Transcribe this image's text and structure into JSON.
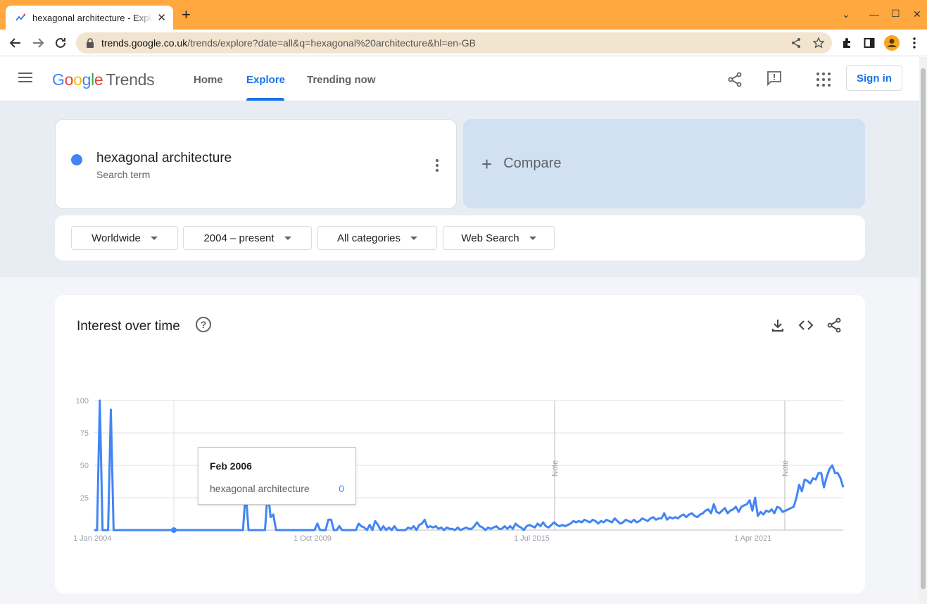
{
  "browser": {
    "tab_title": "hexagonal architecture - Explore - Google Trends",
    "url_host": "trends.google.co.uk",
    "url_path": "/trends/explore?date=all&q=hexagonal%20architecture&hl=en-GB",
    "tab_color": "#ffa840"
  },
  "header": {
    "logo_google": "Google",
    "logo_trends": "Trends",
    "nav": [
      {
        "label": "Home"
      },
      {
        "label": "Explore"
      },
      {
        "label": "Trending now"
      }
    ],
    "active_nav": "Explore",
    "signin_label": "Sign in",
    "accent": "#1a73e8"
  },
  "search": {
    "term": "hexagonal architecture",
    "term_sub": "Search term",
    "term_color": "#4285f4",
    "compare_label": "Compare",
    "compare_plus": "+"
  },
  "filters": {
    "region": "Worldwide",
    "time": "2004 – present",
    "category": "All categories",
    "search_type": "Web Search"
  },
  "iot": {
    "title": "Interest over time",
    "help": "?",
    "tooltip": {
      "date": "Feb 2006",
      "term": "hexagonal architecture",
      "value": "0"
    }
  },
  "chart_data": {
    "type": "line",
    "title": "Interest over time",
    "series": [
      {
        "name": "hexagonal architecture",
        "color": "#4285f4"
      }
    ],
    "ylim": [
      0,
      100
    ],
    "yticks": [
      "100",
      "75",
      "50",
      "25"
    ],
    "xticks": [
      "1 Jan 2004",
      "1 Oct 2009",
      "1 Jul 2015",
      "1 Apr 2021"
    ],
    "notes": [
      "Note",
      "Note"
    ],
    "grid": true,
    "values": [
      0,
      0,
      100,
      0,
      0,
      0,
      93,
      0,
      0,
      0,
      0,
      0,
      0,
      0,
      0,
      0,
      0,
      0,
      0,
      0,
      0,
      0,
      0,
      0,
      0,
      0,
      0,
      0,
      0,
      0,
      0,
      0,
      0,
      0,
      0,
      0,
      0,
      0,
      0,
      0,
      0,
      0,
      0,
      0,
      0,
      0,
      0,
      0,
      0,
      0,
      0,
      0,
      0,
      0,
      0,
      30,
      0,
      0,
      0,
      0,
      0,
      0,
      0,
      31,
      10,
      12,
      0,
      0,
      0,
      0,
      0,
      0,
      0,
      0,
      0,
      0,
      0,
      0,
      0,
      0,
      0,
      5,
      0,
      0,
      0,
      8,
      8,
      0,
      0,
      3,
      0,
      0,
      0,
      0,
      0,
      0,
      5,
      3,
      2,
      0,
      4,
      0,
      7,
      4,
      0,
      3,
      0,
      2,
      0,
      3,
      0,
      0,
      0,
      0,
      2,
      1,
      3,
      0,
      4,
      5,
      8,
      2,
      3,
      2,
      3,
      1,
      2,
      0,
      2,
      1,
      1,
      0,
      2,
      0,
      1,
      2,
      1,
      1,
      3,
      6,
      3,
      2,
      0,
      2,
      1,
      2,
      3,
      1,
      1,
      3,
      1,
      3,
      1,
      5,
      3,
      2,
      0,
      3,
      4,
      3,
      2,
      5,
      3,
      6,
      3,
      2,
      4,
      6,
      4,
      3,
      4,
      3,
      4,
      5,
      7,
      6,
      7,
      6,
      8,
      7,
      6,
      8,
      7,
      5,
      7,
      6,
      8,
      7,
      6,
      9,
      7,
      5,
      6,
      8,
      7,
      6,
      8,
      6,
      7,
      9,
      8,
      7,
      9,
      10,
      8,
      9,
      9,
      13,
      8,
      10,
      9,
      10,
      9,
      11,
      12,
      10,
      12,
      13,
      11,
      10,
      12,
      13,
      15,
      16,
      13,
      20,
      14,
      13,
      15,
      17,
      13,
      15,
      16,
      18,
      14,
      18,
      19,
      20,
      23,
      15,
      25,
      11,
      14,
      12,
      15,
      14,
      16,
      13,
      18,
      17,
      14,
      15,
      16,
      17,
      18,
      25,
      35,
      30,
      39,
      38,
      36,
      40,
      39,
      44,
      44,
      33,
      41,
      47,
      50,
      44,
      44,
      40,
      33
    ]
  }
}
